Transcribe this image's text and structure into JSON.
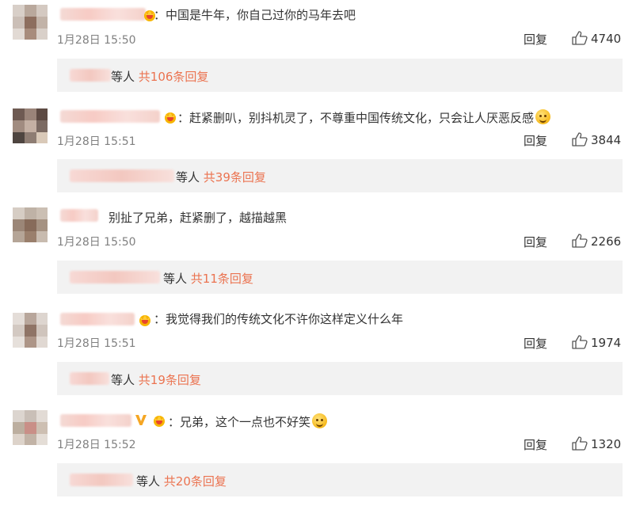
{
  "colors": {
    "accent": "#eb7350",
    "text": "#333333",
    "muted": "#808080",
    "sub_bg": "#f2f2f2"
  },
  "icons": {
    "like": "thumbs-up-icon",
    "badge": "crown-badge-icon",
    "emoji": "smile-emoji-icon",
    "vip": "vip-v-icon"
  },
  "comments": [
    {
      "text": "：中国是牛年，你自己过你的马年去吧",
      "time": "1月28日 15:50",
      "reply_label": "回复",
      "likes": "4740",
      "sub_who": "等人",
      "sub_count": "共106条回复"
    },
    {
      "text": "：赶紧删叭，别抖机灵了，不尊重中国传统文化，只会让人厌恶反感",
      "time": "1月28日 15:51",
      "reply_label": "回复",
      "likes": "3844",
      "sub_who": "等人",
      "sub_count": "共39条回复"
    },
    {
      "text": "别扯了兄弟，赶紧删了，越描越黑",
      "time": "1月28日 15:50",
      "reply_label": "回复",
      "likes": "2266",
      "sub_who": "等人",
      "sub_count": "共11条回复"
    },
    {
      "text": "：我觉得我们的传统文化不许你这样定义什么年",
      "time": "1月28日 15:51",
      "reply_label": "回复",
      "likes": "1974",
      "sub_who": "等人",
      "sub_count": "共19条回复"
    },
    {
      "text": "：兄弟，这个一点也不好笑",
      "time": "1月28日 15:52",
      "reply_label": "回复",
      "likes": "1320",
      "sub_who": "等人",
      "sub_count": "共20条回复"
    }
  ]
}
